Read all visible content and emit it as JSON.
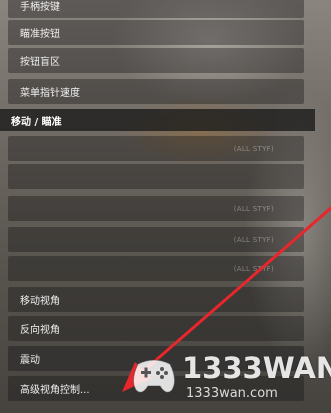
{
  "menu": {
    "items_top": [
      {
        "label": "手柄按键"
      },
      {
        "label": "瞄准按钮"
      },
      {
        "label": "按钮盲区"
      },
      {
        "label": "菜单指针速度"
      }
    ],
    "section_title": "移动 / 瞄准",
    "items_settings": [
      {
        "label": "",
        "value": "(ALL STYF)"
      },
      {
        "label": "",
        "value": ""
      },
      {
        "label": "",
        "value": "(ALL STYF)"
      },
      {
        "label": "",
        "value": "(ALL STYF)"
      },
      {
        "label": "",
        "value": "(ALL STYF)"
      }
    ],
    "items_bottom": [
      {
        "label": "移动视角"
      },
      {
        "label": "反向视角"
      },
      {
        "label": "震动"
      },
      {
        "label": "高级视角控制..."
      }
    ]
  },
  "watermark": {
    "brand": "1333WAN",
    "url": "1333wan.com"
  },
  "colors": {
    "arrow": "#e8262c",
    "menu_row_bg": "rgba(20,20,20,0.38)",
    "section_bg": "rgba(25,25,25,0.78)"
  }
}
